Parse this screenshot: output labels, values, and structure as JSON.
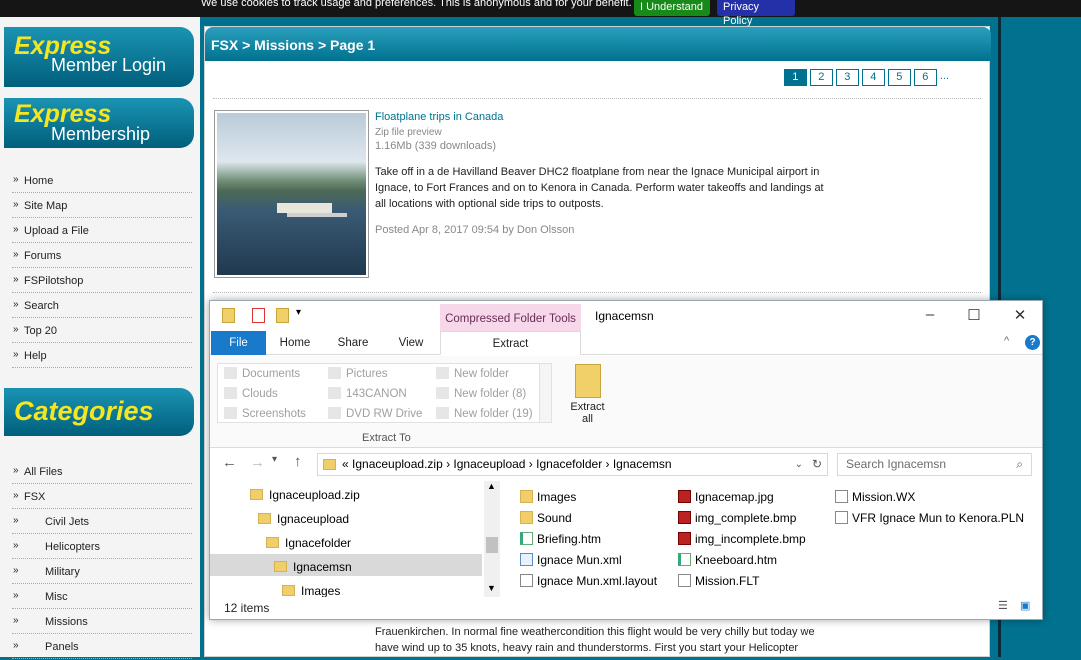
{
  "cookie": {
    "message": "We use cookies to track usage and preferences. This is anonymous and for your benefit.",
    "accept": "I Understand",
    "privacy": "Privacy Policy"
  },
  "sidebar": {
    "login": {
      "title": "Express",
      "sub": "Member Login"
    },
    "membership": {
      "title": "Express",
      "sub": "Membership"
    },
    "nav": [
      "Home",
      "Site Map",
      "Upload a File",
      "Forums",
      "FSPilotshop",
      "Search",
      "Top 20",
      "Help"
    ],
    "categories_title": "Categories",
    "categories": [
      {
        "label": "All Files",
        "sub": false
      },
      {
        "label": "FSX",
        "sub": false
      },
      {
        "label": "Civil Jets",
        "sub": true
      },
      {
        "label": "Helicopters",
        "sub": true
      },
      {
        "label": "Military",
        "sub": true
      },
      {
        "label": "Misc",
        "sub": true
      },
      {
        "label": "Missions",
        "sub": true
      },
      {
        "label": "Panels",
        "sub": true
      }
    ]
  },
  "main": {
    "breadcrumb": "FSX > Missions > Page 1",
    "pager": [
      "1",
      "2",
      "3",
      "4",
      "5",
      "6",
      "..."
    ],
    "entry": {
      "title": "Floatplane trips in Canada",
      "preview": "Zip file preview",
      "size": "1.16Mb (339 downloads)",
      "description": "Take off in a de Havilland Beaver DHC2 floatplane from near the Ignace Municipal airport in Ignace, to Fort Frances and on to Kenora in Canada. Perform water takeoffs and landings at all locations with optional side trips to outposts.",
      "posted": "Posted Apr 8, 2017 09:54 by Don Olsson"
    },
    "bottom_text": "Frauenkirchen. In normal fine weathercondition this flight would be very chilly but today we have wind up to 35 knots, heavy rain and thunderstorms. First you start your Helicopter"
  },
  "explorer": {
    "context_tab": "Compressed Folder Tools",
    "title": "Ignacemsn",
    "tabs": {
      "file": "File",
      "home": "Home",
      "share": "Share",
      "view": "View",
      "extract": "Extract"
    },
    "gallery": [
      "Documents",
      "Pictures",
      "New folder",
      "Clouds",
      "143CANON",
      "New folder (8)",
      "Screenshots",
      "DVD RW Drive",
      "New folder (19)"
    ],
    "extract_to": "Extract To",
    "extract_all": "Extract all",
    "address": "«  Ignaceupload.zip  ›  Ignaceupload  ›  Ignacefolder  ›  Ignacemsn",
    "search_placeholder": "Search Ignacemsn",
    "tree": [
      "Ignaceupload.zip",
      "Ignaceupload",
      "Ignacefolder",
      "Ignacemsn",
      "Images"
    ],
    "files": [
      {
        "name": "Images",
        "type": "folder"
      },
      {
        "name": "Sound",
        "type": "folder"
      },
      {
        "name": "Briefing.htm",
        "type": "web"
      },
      {
        "name": "Ignace Mun.xml",
        "type": "xml"
      },
      {
        "name": "Ignace Mun.xml.layout",
        "type": "file"
      },
      {
        "name": "Ignacemap.jpg",
        "type": "img"
      },
      {
        "name": "img_complete.bmp",
        "type": "img"
      },
      {
        "name": "img_incomplete.bmp",
        "type": "img"
      },
      {
        "name": "Kneeboard.htm",
        "type": "web"
      },
      {
        "name": "Mission.FLT",
        "type": "file"
      },
      {
        "name": "Mission.WX",
        "type": "file"
      },
      {
        "name": "VFR Ignace Mun to Kenora.PLN",
        "type": "file"
      }
    ],
    "status": "12 items"
  }
}
